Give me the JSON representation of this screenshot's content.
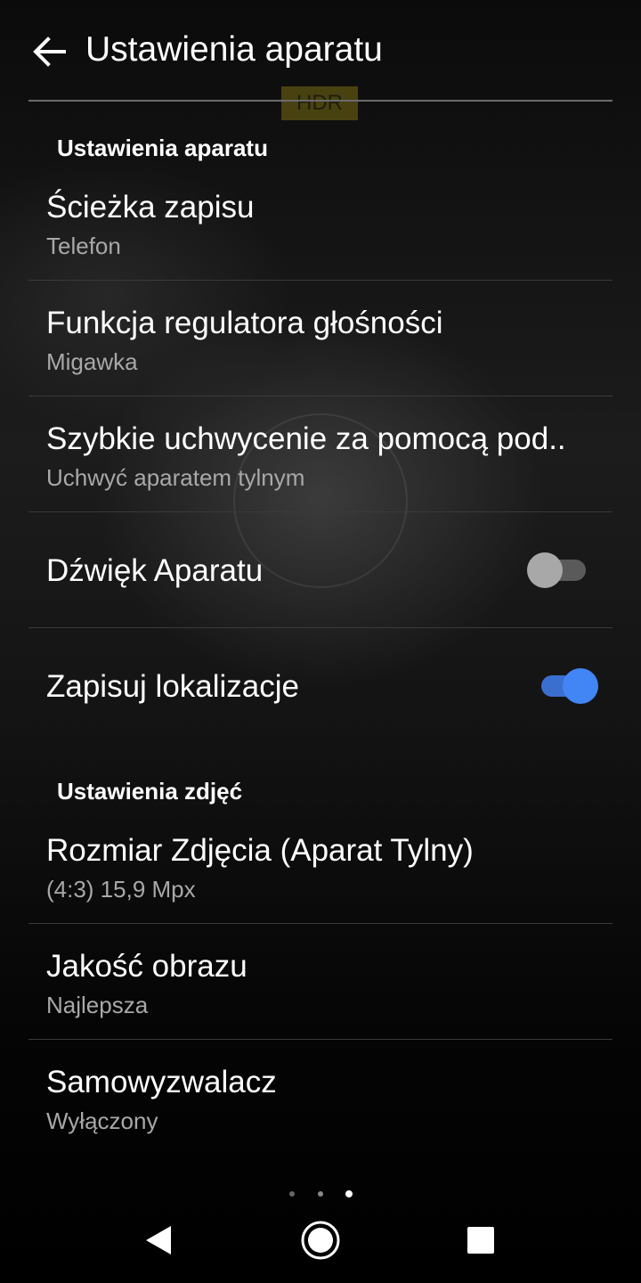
{
  "header": {
    "title": "Ustawienia aparatu",
    "back_icon": "arrow-left-icon"
  },
  "overlay": {
    "hdr_badge": "HDR"
  },
  "sections": {
    "camera": {
      "header": "Ustawienia aparatu",
      "items": [
        {
          "title": "Ścieżka zapisu",
          "value": "Telefon"
        },
        {
          "title": "Funkcja regulatora głośności",
          "value": "Migawka"
        },
        {
          "title": "Szybkie uchwycenie za pomocą pod..",
          "value": "Uchwyć aparatem tylnym"
        }
      ],
      "toggles": [
        {
          "title": "Dźwięk Aparatu",
          "state": "off"
        },
        {
          "title": "Zapisuj lokalizacje",
          "state": "on"
        }
      ]
    },
    "photo": {
      "header": "Ustawienia zdjęć",
      "items": [
        {
          "title": "Rozmiar Zdjęcia (Aparat Tylny)",
          "value": "(4:3) 15,9 Mpx"
        },
        {
          "title": "Jakość obrazu",
          "value": "Najlepsza"
        },
        {
          "title": "Samowyzwalacz",
          "value": "Wyłączony"
        }
      ]
    }
  },
  "page_indicator": {
    "count": 3,
    "active": 3
  },
  "colors": {
    "accent": "#4285f4",
    "accent_track": "#3a6fd0",
    "toggle_off_thumb": "#a8a8a8",
    "toggle_off_track": "#5a5a5a",
    "secondary_text": "#a8a8a8"
  },
  "navbar": {
    "icons": [
      "back-triangle-icon",
      "home-circle-icon",
      "recents-square-icon"
    ]
  }
}
